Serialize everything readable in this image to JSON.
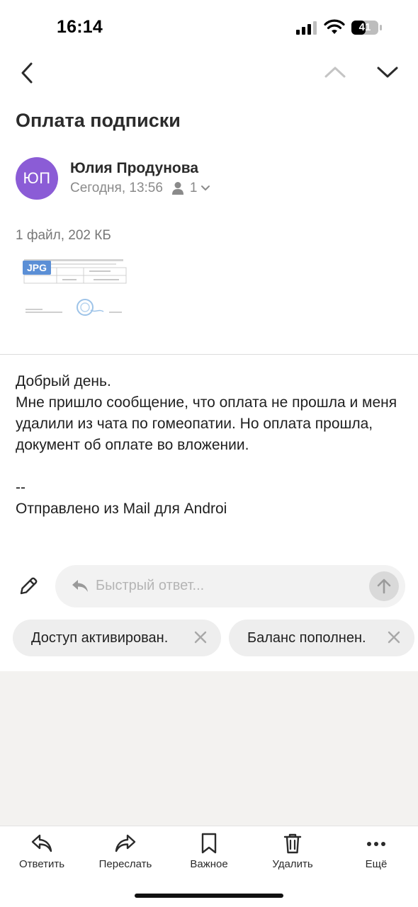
{
  "status": {
    "time": "16:14",
    "battery": "41"
  },
  "email": {
    "subject": "Оплата подписки",
    "avatar_initials": "ЮП",
    "avatar_color": "#8b5cd6",
    "sender": "Юлия Продунова",
    "date": "Сегодня, 13:56",
    "recipients_count": "1",
    "files_info": "1 файл, 202 КБ",
    "attachment_type": "JPG",
    "body": [
      "Добрый день.",
      "Мне пришло сообщение, что оплата не прошла и меня удалили из чата по гомеопатии. Но оплата прошла, документ об оплате во вложении."
    ],
    "signature_sep": "--",
    "signature": "Отправлено из Mail для Androi"
  },
  "reply": {
    "placeholder": "Быстрый ответ...",
    "suggestions": [
      "Доступ активирован.",
      "Баланс пополнен."
    ]
  },
  "toolbar": {
    "reply": "Ответить",
    "forward": "Переслать",
    "important": "Важное",
    "delete": "Удалить",
    "more": "Ещё"
  }
}
